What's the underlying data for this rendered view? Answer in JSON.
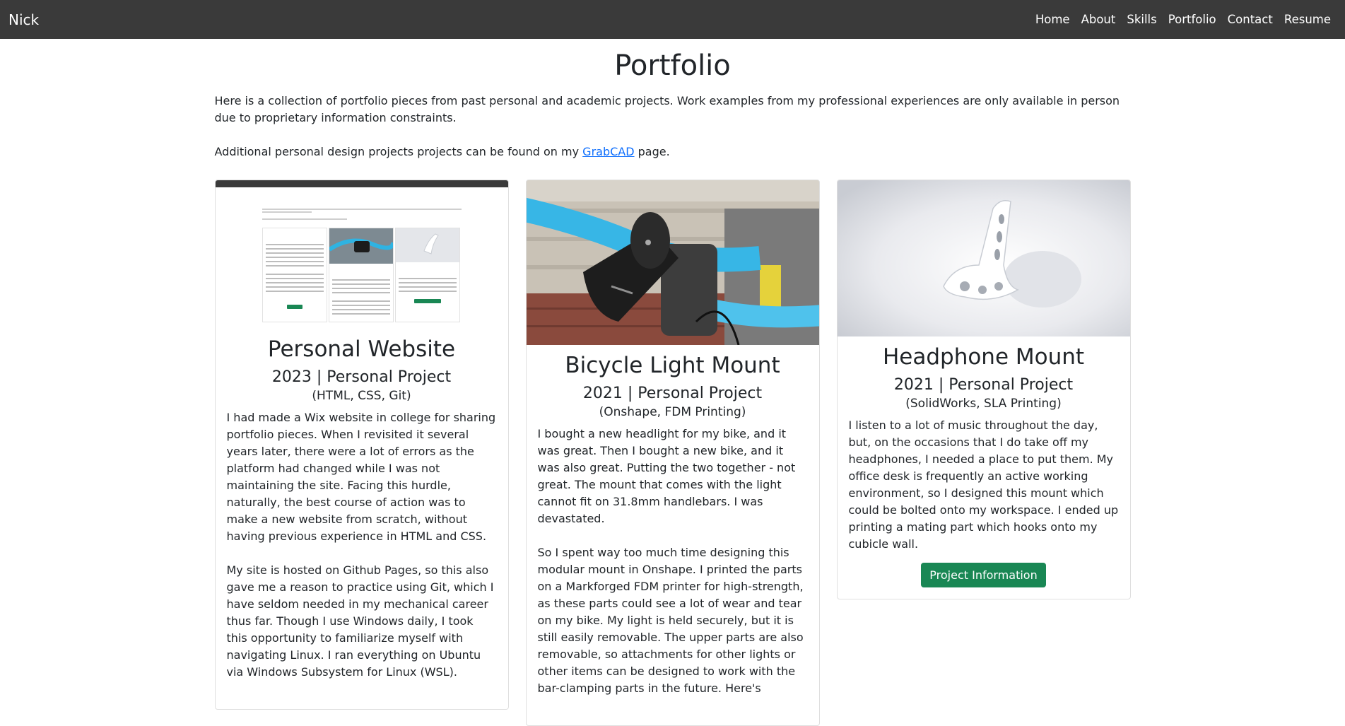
{
  "nav": {
    "brand": "Nick",
    "links": [
      "Home",
      "About",
      "Skills",
      "Portfolio",
      "Contact",
      "Resume"
    ]
  },
  "page": {
    "title": "Portfolio",
    "intro1": "Here is a collection of portfolio pieces from past personal and academic projects. Work examples from my professional experiences are only available in person due to proprietary information constraints.",
    "intro2_before": "Additional personal design projects projects can be found on my ",
    "intro2_link": "GrabCAD",
    "intro2_after": " page."
  },
  "cards": [
    {
      "title": "Personal Website",
      "subtitle": "2023 | Personal Project",
      "tech": "(HTML, CSS, Git)",
      "p1": "I had made a Wix website in college for sharing portfolio pieces. When I revisited it several years later, there were a lot of errors as the platform had changed while I was not maintaining the site. Facing this hurdle, naturally, the best course of action was to make a new website from scratch, without having previous experience in HTML and CSS.",
      "p2": "My site is hosted on Github Pages, so this also gave me a reason to practice using Git, which I have seldom needed in my mechanical career thus far. Though I use Windows daily, I took this opportunity to familiarize myself with navigating Linux. I ran everything on Ubuntu via Windows Subsystem for Linux (WSL)."
    },
    {
      "title": "Bicycle Light Mount",
      "subtitle": "2021 | Personal Project",
      "tech": "(Onshape, FDM Printing)",
      "p1": "I bought a new headlight for my bike, and it was great. Then I bought a new bike, and it was also great. Putting the two together - not great. The mount that comes with the light cannot fit on 31.8mm handlebars. I was devastated.",
      "p2": "So I spent way too much time designing this modular mount in Onshape. I printed the parts on a Markforged FDM printer for high-strength, as these parts could see a lot of wear and tear on my bike. My light is held securely, but it is still easily removable. The upper parts are also removable, so attachments for other lights or other items can be designed to work with the bar-clamping parts in the future. Here's"
    },
    {
      "title": "Headphone Mount",
      "subtitle": "2021 | Personal Project",
      "tech": "(SolidWorks, SLA Printing)",
      "p1": "I listen to a lot of music throughout the day, but, on the occasions that I do take off my headphones, I needed a place to put them. My office desk is frequently an active working environment, so I designed this mount which could be bolted onto my workspace. I ended up printing a mating part which hooks onto my cubicle wall.",
      "button": "Project Information"
    }
  ],
  "colors": {
    "navbar": "#3a3a3a",
    "button": "#198754",
    "link": "#0d6efd"
  }
}
